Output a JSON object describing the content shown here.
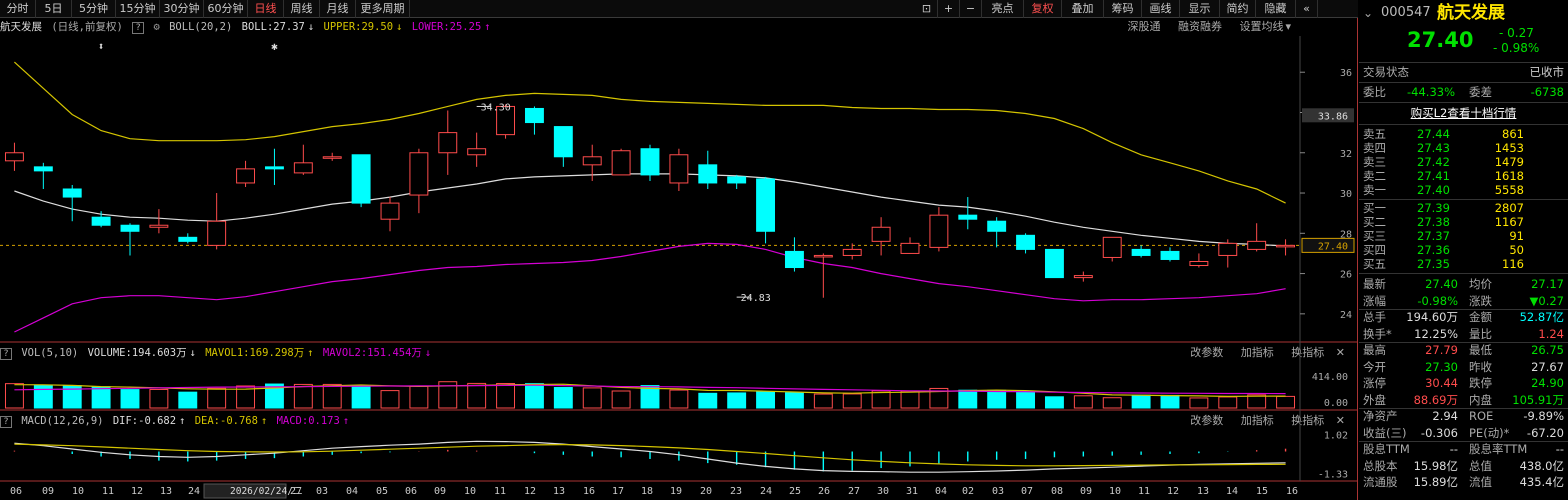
{
  "toolbar": {
    "left": [
      "分时",
      "5日",
      "5分钟",
      "15分钟",
      "30分钟",
      "60分钟",
      "日线",
      "周线",
      "月线",
      "更多周期"
    ],
    "active": "日线",
    "right": [
      "⊡",
      "+",
      "−",
      "亮点",
      "复权",
      "叠加",
      "筹码",
      "画线",
      "显示",
      "简约",
      "隐藏"
    ],
    "right_active": "复权",
    "collapse_icon": "«"
  },
  "main_info": {
    "name": "航天发展",
    "mode": "(日线,前复权)",
    "help": "?",
    "indicator": "BOLL(20,2)",
    "boll": "BOLL:27.37",
    "upper": "UPPER:29.50",
    "lower": "LOWER:25.25",
    "links": [
      "深股通",
      "融资融券",
      "设置均线"
    ]
  },
  "vol_info": {
    "name": "VOL(5,10)",
    "volume": "VOLUME:194.603万",
    "mavol1": "MAVOL1:169.298万",
    "mavol2": "MAVOL2:151.454万",
    "links": [
      "改参数",
      "加指标",
      "换指标"
    ]
  },
  "macd_info": {
    "name": "MACD(12,26,9)",
    "dif": "DIF:-0.682",
    "dea": "DEA:-0.768",
    "macd": "MACD:0.173",
    "links": [
      "改参数",
      "加指标",
      "换指标"
    ]
  },
  "colors": {
    "up": "#ff4c4c",
    "down": "#00ffff",
    "boll_mid": "#dddddd",
    "boll_upper": "#d4c400",
    "boll_lower": "#d400d4",
    "mavol1": "#d4c400",
    "mavol2": "#d400d4",
    "dif": "#dddddd",
    "dea": "#d4c400",
    "price_line": "#d4a000"
  },
  "chart_data": [
    {
      "type": "candlestick",
      "price_axis": {
        "ticks": [
          36.0,
          34.0,
          32.0,
          30.0,
          28.0,
          26.0,
          24.0
        ],
        "min": 22.8,
        "max": 37.6
      },
      "current_price": "27.40",
      "current_value": 27.4,
      "highlight_value": "33.86",
      "highlight_level": 33.86,
      "ohlc": [
        [
          31.6,
          32.0,
          31.1,
          32.5
        ],
        [
          31.3,
          31.1,
          30.2,
          31.5
        ],
        [
          30.2,
          29.8,
          28.6,
          30.4
        ],
        [
          28.8,
          28.4,
          28.3,
          29.1
        ],
        [
          28.4,
          28.1,
          26.9,
          28.5
        ],
        [
          28.3,
          28.4,
          28.0,
          29.2
        ],
        [
          27.8,
          27.6,
          27.5,
          28.0
        ],
        [
          27.4,
          28.6,
          27.2,
          30.0
        ],
        [
          30.5,
          31.2,
          30.3,
          31.6
        ],
        [
          31.3,
          31.2,
          30.4,
          32.2
        ],
        [
          31.0,
          31.5,
          30.9,
          32.4
        ],
        [
          31.8,
          31.8,
          31.6,
          32.0
        ],
        [
          31.9,
          29.5,
          29.3,
          31.9
        ],
        [
          28.7,
          29.5,
          28.1,
          29.8
        ],
        [
          29.9,
          32.0,
          29.0,
          32.2
        ],
        [
          32.0,
          33.0,
          30.9,
          34.1
        ],
        [
          31.9,
          32.2,
          31.3,
          33.0
        ],
        [
          32.9,
          34.3,
          32.7,
          34.4
        ],
        [
          34.2,
          33.5,
          32.9,
          34.3
        ],
        [
          33.3,
          31.8,
          31.3,
          33.3
        ],
        [
          31.4,
          31.8,
          30.6,
          32.4
        ],
        [
          30.9,
          32.1,
          30.9,
          32.2
        ],
        [
          32.2,
          30.9,
          30.6,
          32.4
        ],
        [
          30.5,
          31.9,
          30.1,
          32.2
        ],
        [
          31.4,
          30.5,
          30.2,
          32.1
        ],
        [
          30.8,
          30.5,
          30.2,
          30.9
        ],
        [
          30.7,
          28.1,
          27.5,
          30.8
        ],
        [
          27.1,
          26.3,
          26.1,
          27.8
        ],
        [
          26.9,
          26.9,
          24.8,
          27.0
        ],
        [
          26.9,
          27.2,
          26.7,
          27.5
        ],
        [
          27.6,
          28.3,
          26.9,
          28.8
        ],
        [
          27.0,
          27.5,
          27.0,
          27.8
        ],
        [
          27.3,
          28.9,
          27.1,
          29.3
        ],
        [
          28.9,
          28.7,
          28.2,
          29.8
        ],
        [
          28.6,
          28.1,
          27.3,
          28.8
        ],
        [
          27.9,
          27.2,
          27.0,
          28.0
        ],
        [
          27.2,
          25.8,
          25.8,
          27.2
        ],
        [
          25.8,
          25.9,
          25.6,
          26.1
        ],
        [
          26.8,
          27.8,
          26.6,
          27.8
        ],
        [
          27.2,
          26.9,
          26.8,
          27.4
        ],
        [
          27.1,
          26.7,
          26.6,
          27.3
        ],
        [
          26.4,
          26.6,
          26.3,
          27.0
        ],
        [
          26.9,
          27.5,
          26.3,
          27.7
        ],
        [
          27.2,
          27.6,
          27.1,
          28.5
        ],
        [
          27.4,
          27.4,
          26.9,
          27.7
        ]
      ],
      "boll_mid": [
        30.1,
        29.6,
        29.2,
        28.95,
        28.8,
        28.75,
        28.65,
        28.6,
        28.75,
        28.95,
        29.2,
        29.45,
        29.6,
        29.8,
        30.05,
        30.25,
        30.45,
        30.7,
        30.8,
        30.85,
        30.9,
        30.95,
        30.95,
        30.95,
        30.9,
        30.85,
        30.75,
        30.55,
        30.3,
        30.05,
        29.8,
        29.6,
        29.4,
        29.3,
        29.1,
        28.85,
        28.55,
        28.3,
        28.1,
        27.9,
        27.75,
        27.6,
        27.5,
        27.45,
        27.37
      ],
      "boll_upper": [
        36.5,
        35.2,
        33.9,
        33.1,
        32.7,
        32.6,
        32.6,
        32.6,
        32.65,
        32.8,
        33.05,
        33.3,
        33.45,
        33.65,
        33.95,
        34.3,
        34.65,
        34.85,
        34.95,
        34.9,
        34.85,
        34.65,
        34.55,
        34.5,
        34.45,
        34.4,
        34.35,
        34.35,
        34.35,
        34.25,
        34.2,
        34.2,
        34.15,
        34.15,
        34.1,
        33.95,
        33.7,
        33.2,
        32.5,
        31.9,
        31.5,
        31.1,
        30.6,
        30.2,
        29.5
      ],
      "boll_lower": [
        23.1,
        23.8,
        24.5,
        24.8,
        24.9,
        24.9,
        24.8,
        24.7,
        24.85,
        25.1,
        25.35,
        25.6,
        25.75,
        25.95,
        26.15,
        26.3,
        26.35,
        26.45,
        26.5,
        26.55,
        26.65,
        26.85,
        27.1,
        27.35,
        27.5,
        27.45,
        27.2,
        26.8,
        26.5,
        26.3,
        26.0,
        25.75,
        25.5,
        25.35,
        25.15,
        24.95,
        24.75,
        24.65,
        24.7,
        24.7,
        24.75,
        24.8,
        24.9,
        25.0,
        25.25
      ],
      "annotations": [
        {
          "text": "34.30",
          "index": 16,
          "value": 34.3,
          "dir": "left"
        },
        {
          "text": "24.83",
          "index": 25,
          "value": 24.83,
          "dir": "left"
        }
      ],
      "markers": [
        {
          "symbol": "⬍",
          "index": 3
        },
        {
          "symbol": "✱",
          "index": 9
        }
      ]
    },
    {
      "type": "bar",
      "name": "VOL",
      "axis_ticks": [
        "414.00",
        "0.00"
      ],
      "max": 414,
      "values": [
        315,
        295,
        290,
        275,
        238,
        240,
        205,
        255,
        285,
        310,
        305,
        305,
        283,
        225,
        280,
        340,
        318,
        317,
        315,
        265,
        260,
        220,
        290,
        232,
        190,
        195,
        210,
        198,
        180,
        182,
        222,
        218,
        253,
        230,
        228,
        215,
        145,
        158,
        133,
        166,
        163,
        130,
        143,
        170,
        150
      ],
      "mavol1": [
        302,
        300,
        292,
        277,
        270,
        260,
        248,
        243,
        244,
        259,
        278,
        289,
        297,
        286,
        280,
        286,
        292,
        300,
        304,
        308,
        287,
        266,
        254,
        247,
        228,
        226,
        217,
        207,
        195,
        192,
        200,
        204,
        213,
        225,
        232,
        225,
        210,
        190,
        170,
        166,
        161,
        157,
        150,
        153,
        154
      ],
      "mavol2": [
        235,
        240,
        245,
        250,
        255,
        260,
        265,
        270,
        272,
        273,
        275,
        279,
        282,
        285,
        286,
        287,
        290,
        292,
        295,
        290,
        285,
        277,
        275,
        273,
        267,
        262,
        255,
        247,
        241,
        236,
        229,
        222,
        220,
        218,
        214,
        211,
        205,
        200,
        197,
        194,
        192,
        190,
        188,
        187,
        186
      ]
    },
    {
      "type": "bar",
      "name": "MACD",
      "axis_ticks": [
        "1.02",
        "-1.33"
      ],
      "min": -1.6,
      "max": 1.3,
      "values": [
        0.05,
        0.0,
        -0.15,
        -0.3,
        -0.45,
        -0.55,
        -0.6,
        -0.55,
        -0.45,
        -0.4,
        -0.3,
        -0.2,
        -0.1,
        -0.05,
        0.02,
        0.1,
        0.05,
        0.0,
        -0.1,
        -0.2,
        -0.3,
        -0.35,
        -0.45,
        -0.55,
        -0.7,
        -0.8,
        -0.95,
        -1.1,
        -1.2,
        -1.15,
        -1.0,
        -0.9,
        -0.75,
        -0.6,
        -0.5,
        -0.45,
        -0.35,
        -0.3,
        -0.25,
        -0.2,
        -0.15,
        -0.1,
        -0.02,
        0.08,
        0.17
      ],
      "dif": [
        0.5,
        0.35,
        0.15,
        -0.05,
        -0.2,
        -0.3,
        -0.35,
        -0.3,
        -0.2,
        -0.1,
        0.05,
        0.2,
        0.3,
        0.38,
        0.45,
        0.55,
        0.62,
        0.6,
        0.55,
        0.45,
        0.3,
        0.15,
        0.0,
        -0.2,
        -0.45,
        -0.7,
        -0.9,
        -1.05,
        -1.15,
        -1.2,
        -1.22,
        -1.25,
        -1.25,
        -1.22,
        -1.18,
        -1.12,
        -1.05,
        -1.0,
        -0.95,
        -0.88,
        -0.82,
        -0.78,
        -0.74,
        -0.71,
        -0.68
      ],
      "dea": [
        0.45,
        0.4,
        0.35,
        0.28,
        0.2,
        0.12,
        0.05,
        0.0,
        -0.02,
        -0.03,
        -0.02,
        0.02,
        0.08,
        0.14,
        0.2,
        0.26,
        0.32,
        0.36,
        0.4,
        0.42,
        0.4,
        0.36,
        0.3,
        0.22,
        0.12,
        0.0,
        -0.12,
        -0.25,
        -0.38,
        -0.5,
        -0.6,
        -0.68,
        -0.75,
        -0.8,
        -0.84,
        -0.86,
        -0.86,
        -0.85,
        -0.84,
        -0.82,
        -0.81,
        -0.8,
        -0.79,
        -0.78,
        -0.77
      ]
    },
    {
      "type": "axis",
      "dates": [
        "06",
        "09",
        "10",
        "11",
        "12",
        "13",
        "24",
        "2026/02/24/二",
        "27",
        "03",
        "04",
        "05",
        "06",
        "09",
        "10",
        "11",
        "12",
        "13",
        "16",
        "17",
        "18",
        "19",
        "20",
        "23",
        "24",
        "25",
        "26",
        "27",
        "30",
        "31",
        "04",
        "02",
        "03",
        "07",
        "08",
        "09",
        "10",
        "11",
        "12",
        "13",
        "14",
        "15",
        "16"
      ]
    }
  ],
  "right_panel": {
    "code": "000547",
    "name": "航天发展",
    "price": "27.40",
    "change": "- 0.27",
    "pct": "- 0.98%",
    "status_label": "交易状态",
    "status": "已收市",
    "weibi_label": "委比",
    "weibi": "-44.33%",
    "weicha_label": "委差",
    "weicha": "-6738",
    "l2": "购买L2查看十档行情",
    "sells": [
      [
        "卖五",
        "27.44",
        "861"
      ],
      [
        "卖四",
        "27.43",
        "1453"
      ],
      [
        "卖三",
        "27.42",
        "1479"
      ],
      [
        "卖二",
        "27.41",
        "1618"
      ],
      [
        "卖一",
        "27.40",
        "5558"
      ]
    ],
    "buys": [
      [
        "买一",
        "27.39",
        "2807"
      ],
      [
        "买二",
        "27.38",
        "1167"
      ],
      [
        "买三",
        "27.37",
        "91"
      ],
      [
        "买四",
        "27.36",
        "50"
      ],
      [
        "买五",
        "27.35",
        "116"
      ]
    ],
    "stats": [
      [
        "最新",
        "27.40",
        "g",
        "均价",
        "27.17",
        "g"
      ],
      [
        "涨幅",
        "-0.98%",
        "g",
        "涨跌",
        "▼0.27",
        "g"
      ],
      [
        "总手",
        "194.60万",
        "w",
        "金额",
        "52.87亿",
        "c"
      ],
      [
        "换手*",
        "12.25%",
        "w",
        "量比",
        "1.24",
        "r"
      ],
      [
        "最高",
        "27.79",
        "r",
        "最低",
        "26.75",
        "g"
      ],
      [
        "今开",
        "27.30",
        "g",
        "昨收",
        "27.67",
        "w"
      ],
      [
        "涨停",
        "30.44",
        "r",
        "跌停",
        "24.90",
        "g"
      ],
      [
        "外盘",
        "88.69万",
        "r",
        "内盘",
        "105.91万",
        "g"
      ],
      [
        "净资产",
        "2.94",
        "w",
        "ROE",
        "-9.89%",
        "w"
      ],
      [
        "收益(三)",
        "-0.306",
        "w",
        "PE(动)*",
        "-67.20",
        "w"
      ],
      [
        "股息TTM",
        "--",
        "w",
        "股息率TTM",
        "--",
        "w"
      ],
      [
        "总股本",
        "15.98亿",
        "w",
        "总值",
        "438.0亿",
        "w"
      ],
      [
        "流通股",
        "15.89亿",
        "w",
        "流值",
        "435.4亿",
        "w"
      ]
    ]
  }
}
